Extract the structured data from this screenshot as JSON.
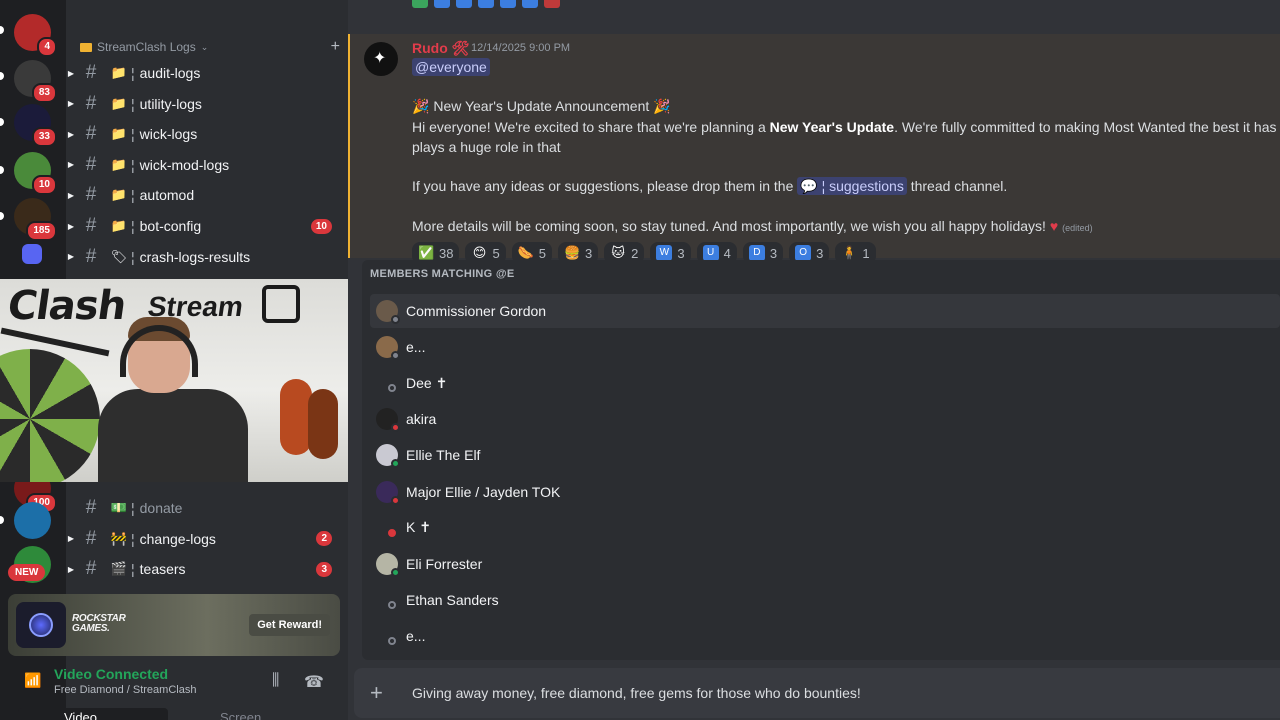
{
  "rail": {
    "badges": [
      "4",
      "83",
      "33",
      "10",
      "185",
      "100"
    ],
    "new_label": "NEW"
  },
  "sidebar": {
    "category": "StreamClash Logs",
    "channels": [
      {
        "name": "audit-logs",
        "emoji": "📁"
      },
      {
        "name": "utility-logs",
        "emoji": "📁"
      },
      {
        "name": "wick-logs",
        "emoji": "📁"
      },
      {
        "name": "wick-mod-logs",
        "emoji": "📁"
      },
      {
        "name": "automod",
        "emoji": "📁"
      },
      {
        "name": "bot-config",
        "emoji": "📁",
        "count": "10"
      },
      {
        "name": "crash-logs-results",
        "emoji": "🏷"
      }
    ],
    "lower_channels": [
      {
        "name": "donate",
        "emoji": "💵"
      },
      {
        "name": "change-logs",
        "emoji": "🚧",
        "count": "2"
      },
      {
        "name": "teasers",
        "emoji": "🎬",
        "count": "3"
      }
    ]
  },
  "webcam": {
    "logo_text": "Clash",
    "logo_text2": "Stream"
  },
  "promo": {
    "brand_line1": "ROCKSTAR",
    "brand_line2": "GAMES.",
    "button": "Get Reward!"
  },
  "voice": {
    "status": "Video Connected",
    "channel": "Free Diamond / StreamClash",
    "tab_video": "Video",
    "tab_screen": "Screen"
  },
  "message": {
    "author": "Rudo",
    "author_tag": "🛠",
    "timestamp": "12/14/2025 9:00 PM",
    "mention": "@everyone",
    "heading": "New Year's Update Announcement",
    "body1_pre": "Hi everyone! We're excited to share that we're planning a ",
    "body1_bold": "New Year's Update",
    "body1_post": ". We're fully committed to making Most Wanted the best it has eve",
    "body2": "plays a huge role in that",
    "body3_pre": "If you have any ideas or suggestions, please drop them in the",
    "body3_channel": "suggestions",
    "body3_post": "thread channel.",
    "body4": "More details will be coming soon, so stay tuned. And most importantly, we wish you all happy holidays!",
    "edited": "(edited)"
  },
  "reactions": [
    {
      "emoji": "✅",
      "count": "38",
      "color": "#3ba55d"
    },
    {
      "emoji": "😊",
      "count": "5",
      "color": "#f0b232"
    },
    {
      "emoji": "🌭",
      "count": "5",
      "color": "#e06c3c"
    },
    {
      "emoji": "🍔",
      "count": "3",
      "color": "#c8843a"
    },
    {
      "emoji": "🐱",
      "count": "2",
      "color": "#f0b232"
    },
    {
      "emoji": "W",
      "count": "3",
      "color": "#3c7ee0"
    },
    {
      "emoji": "U",
      "count": "4",
      "color": "#3c7ee0"
    },
    {
      "emoji": "D",
      "count": "3",
      "color": "#3c7ee0"
    },
    {
      "emoji": "O",
      "count": "3",
      "color": "#3c7ee0"
    },
    {
      "emoji": "🧍",
      "count": "1",
      "color": "#b5a33a"
    }
  ],
  "autocomplete": {
    "header": "MEMBERS MATCHING @E",
    "members": [
      {
        "name": "Commissioner Gordon",
        "status": "offline",
        "avatar": true,
        "color": "#6a5a4a",
        "selected": true
      },
      {
        "name": "e...",
        "status": "offline",
        "avatar": true,
        "color": "#8a6a4a"
      },
      {
        "name": "Dee ✝",
        "status": "offline",
        "avatar": false
      },
      {
        "name": "akira",
        "status": "dnd",
        "avatar": true,
        "color": "#222222"
      },
      {
        "name": "Ellie The Elf",
        "status": "online",
        "avatar": true,
        "color": "#c9c9d2"
      },
      {
        "name": "Major Ellie / Jayden TOK",
        "status": "dnd",
        "avatar": true,
        "color": "#3a2a5a"
      },
      {
        "name": "K ✝",
        "status": "dnd",
        "avatar": false
      },
      {
        "name": "Eli Forrester",
        "status": "online",
        "avatar": true,
        "color": "#b5b5a5"
      },
      {
        "name": "Ethan Sanders",
        "status": "offline",
        "avatar": false
      },
      {
        "name": "e...",
        "status": "offline",
        "avatar": false
      }
    ]
  },
  "composer": {
    "value": "Giving away money, free diamond, free gems for those who do bounties!"
  },
  "colors": {
    "online": "#23a55a",
    "dnd": "#da373c",
    "offline": "#80848e"
  }
}
